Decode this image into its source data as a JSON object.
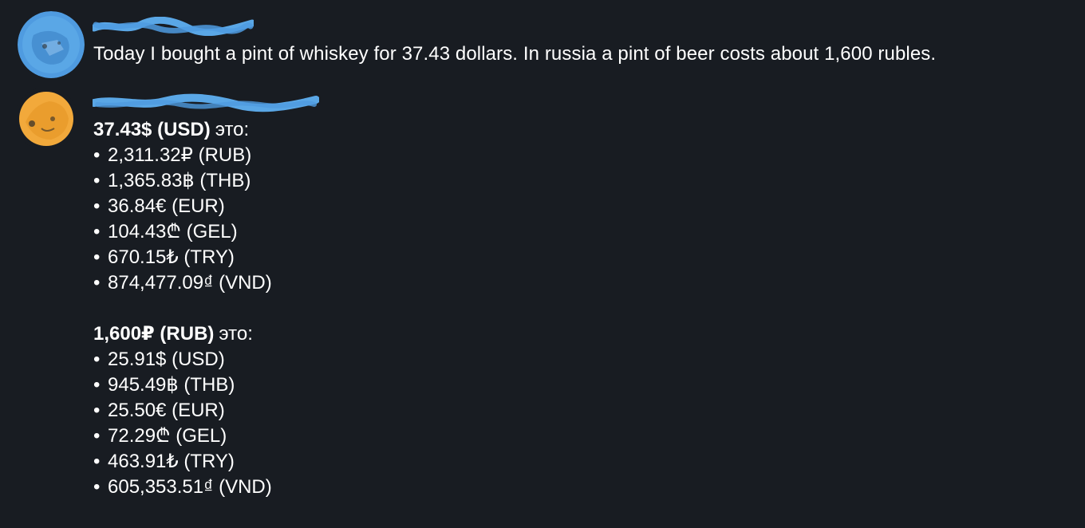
{
  "messages": [
    {
      "author": "",
      "avatar": "blue-blurred-avatar",
      "text": "Today I bought a pint of whiskey for 37.43 dollars. In russia a pint of beer costs about 1,600 rubles."
    },
    {
      "author": "",
      "avatar": "orange-blurred-avatar",
      "conversions": [
        {
          "amount": "37.43$ (USD)",
          "suffix": "это:",
          "items": [
            "2,311.32₽ (RUB)",
            "1,365.83฿ (THB)",
            "36.84€ (EUR)",
            "104.43₾ (GEL)",
            "670.15₺ (TRY)",
            "874,477.09₫ (VND)"
          ]
        },
        {
          "amount": "1,600₽ (RUB)",
          "suffix": "это:",
          "items": [
            "25.91$ (USD)",
            "945.49฿ (THB)",
            "25.50€ (EUR)",
            "72.29₾ (GEL)",
            "463.91₺ (TRY)",
            "605,353.51₫ (VND)"
          ]
        }
      ]
    }
  ],
  "colors": {
    "background": "#181c22",
    "text": "#ffffff",
    "name_scribble_blue": "#5aa7e6",
    "avatar_blue": "#4f9be0",
    "avatar_orange": "#f2a93b"
  },
  "bullet": "•"
}
